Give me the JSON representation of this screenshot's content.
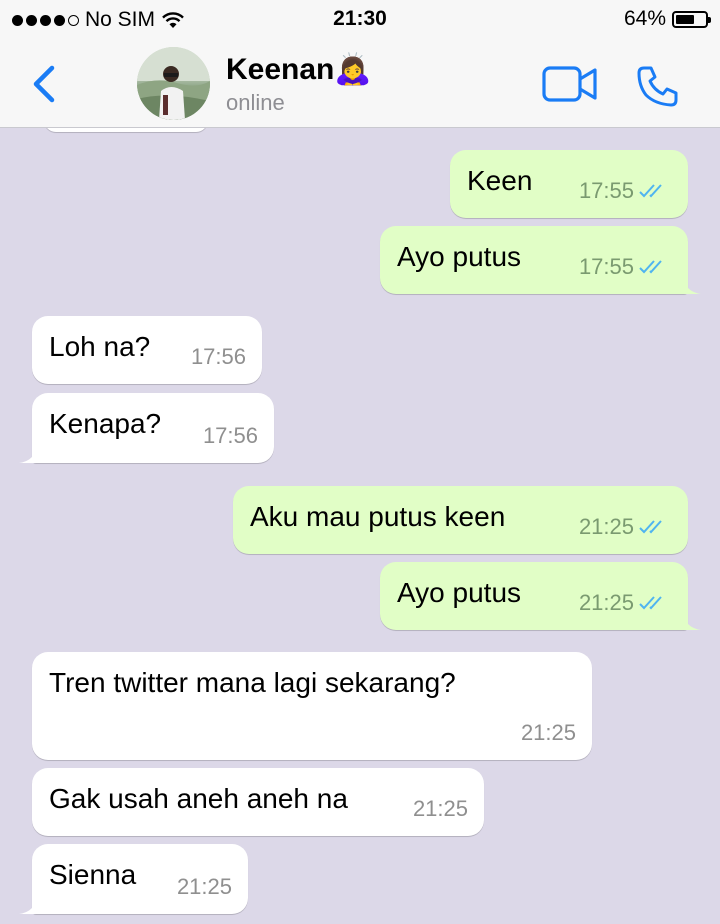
{
  "status_bar": {
    "carrier": "No SIM",
    "time": "21:30",
    "battery_percent": "64%",
    "battery_level": 0.64,
    "signal_bars_filled": 4,
    "signal_bars_total": 5
  },
  "header": {
    "contact_name": "Keenan🙇‍♀️",
    "status": "online"
  },
  "colors": {
    "accent": "#1a7cf5",
    "outgoing_bubble": "#e1fec6",
    "incoming_bubble": "#ffffff",
    "chat_background": "#dcd8e8",
    "read_ticks": "#4fb4f0"
  },
  "messages": [
    {
      "direction": "out",
      "text": "Keen",
      "time": "17:55",
      "read": true
    },
    {
      "direction": "out",
      "text": "Ayo putus",
      "time": "17:55",
      "read": true
    },
    {
      "direction": "in",
      "text": "Loh na?",
      "time": "17:56"
    },
    {
      "direction": "in",
      "text": "Kenapa?",
      "time": "17:56"
    },
    {
      "direction": "out",
      "text": "Aku mau putus keen",
      "time": "21:25",
      "read": true
    },
    {
      "direction": "out",
      "text": "Ayo putus",
      "time": "21:25",
      "read": true
    },
    {
      "direction": "in",
      "text": "Tren twitter mana lagi sekarang?",
      "time": "21:25"
    },
    {
      "direction": "in",
      "text": "Gak usah aneh aneh na",
      "time": "21:25"
    },
    {
      "direction": "in",
      "text": "Sienna",
      "time": "21:25"
    }
  ]
}
